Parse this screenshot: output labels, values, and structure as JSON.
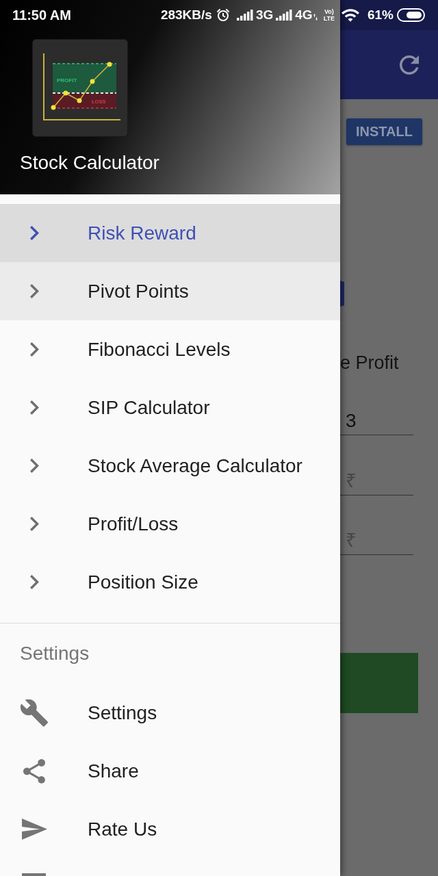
{
  "status_bar": {
    "time": "11:50 AM",
    "net_speed": "283KB/s",
    "networks": [
      {
        "label": "3G",
        "data_activity": false
      },
      {
        "label": "4G",
        "data_activity": true
      }
    ],
    "volte": [
      "Vo)",
      "LTE"
    ],
    "battery": "61%"
  },
  "drawer": {
    "header": {
      "logo_labels": [
        "PROFIT",
        "LOSS"
      ],
      "title": "Stock Calculator"
    },
    "menu_items": [
      {
        "label": "Risk Reward",
        "selected": true,
        "pressed": false
      },
      {
        "label": "Pivot Points",
        "selected": false,
        "pressed": true
      },
      {
        "label": "Fibonacci Levels",
        "selected": false,
        "pressed": false
      },
      {
        "label": "SIP Calculator",
        "selected": false,
        "pressed": false
      },
      {
        "label": "Stock Average Calculator",
        "selected": false,
        "pressed": false
      },
      {
        "label": "Profit/Loss",
        "selected": false,
        "pressed": false
      },
      {
        "label": "Position Size",
        "selected": false,
        "pressed": false
      }
    ],
    "section": {
      "title": "Settings",
      "items": [
        {
          "label": "Settings"
        },
        {
          "label": "Share"
        },
        {
          "label": "Rate Us"
        }
      ]
    }
  },
  "background_app": {
    "install_button": "INSTALL",
    "field_label": "e Profit",
    "fields": [
      {
        "value": "3"
      },
      {
        "placeholder": "₹"
      },
      {
        "placeholder": "₹"
      }
    ]
  }
}
